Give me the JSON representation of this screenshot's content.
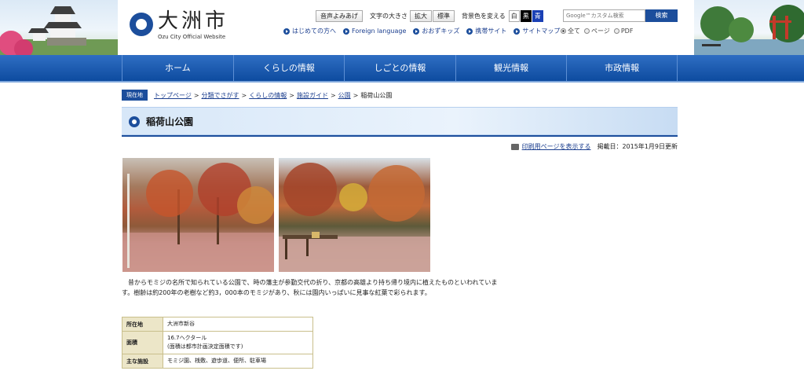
{
  "header": {
    "logo_text": "大洲市",
    "logo_sub": "Ozu City Official Website",
    "voice_button": "音声よみあげ",
    "font_size_label": "文字の大きさ",
    "font_large": "拡大",
    "font_standard": "標準",
    "bg_color_label": "背景色を変える",
    "bg_white": "白",
    "bg_black": "黒",
    "bg_blue": "青",
    "search_placeholder": "Google™カスタム検索",
    "search_button": "検索",
    "links": [
      "はじめての方へ",
      "Foreign language",
      "おおずキッズ",
      "携帯サイト",
      "サイトマップ"
    ],
    "radios": [
      "全て",
      "ページ",
      "PDF"
    ]
  },
  "nav": [
    "ホーム",
    "くらしの情報",
    "しごとの情報",
    "観光情報",
    "市政情報"
  ],
  "breadcrumb": {
    "tag": "現在地",
    "items": [
      "トップページ",
      "分類でさがす",
      "くらしの情報",
      "施設ガイド",
      "公園"
    ],
    "current": "稲荷山公園"
  },
  "page": {
    "title": "稲荷山公園",
    "print_link": "印刷用ページを表示する",
    "date": "掲載日：2015年1月9日更新",
    "description": "　昔からモミジの名所で知られている公園で、時の藩主が参勤交代の折り、京都の高雄より持ち帰り境内に植えたものといわれています。樹齢は約200年の老樹など約3，000本のモミジがあり、秋には園内いっぱいに見事な紅葉で彩られます。"
  },
  "info_table": [
    {
      "label": "所在地",
      "value": "大洲市新谷",
      "value2": ""
    },
    {
      "label": "面積",
      "value": "16.7ヘクタール",
      "value2": "(面積は都市計画決定面積です)"
    },
    {
      "label": "主な施設",
      "value": "モミジ園、桟敷、遊歩道、便所、駐車場",
      "value2": ""
    }
  ]
}
